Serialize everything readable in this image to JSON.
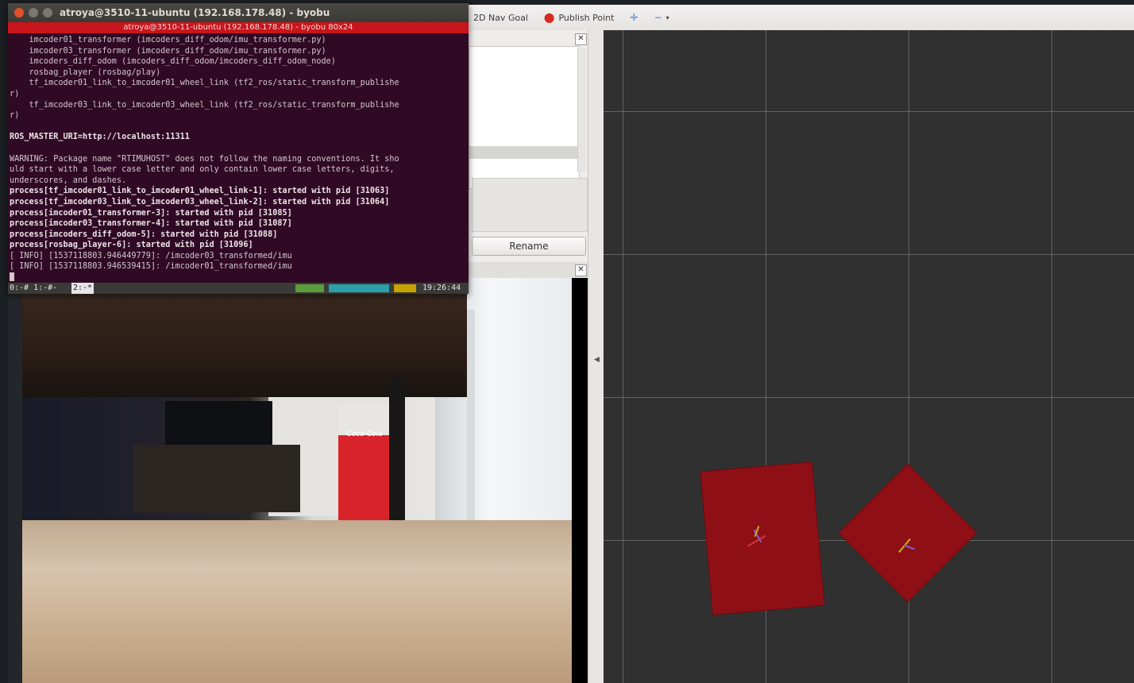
{
  "toolbar": {
    "nav_goal_label": "2D Nav Goal",
    "publish_point_label": "Publish Point"
  },
  "displays": {
    "rename_label": "Rename"
  },
  "terminal": {
    "window_title": "atroya@3510-11-ubuntu (192.168.178.48) - byobu",
    "tab_title": "atroya@3510-11-ubuntu (192.168.178.48) - byobu 80x24",
    "lines": [
      {
        "text": "    imcoder01_transformer (imcoders_diff_odom/imu_transformer.py)",
        "bold": false
      },
      {
        "text": "    imcoder03_transformer (imcoders_diff_odom/imu_transformer.py)",
        "bold": false
      },
      {
        "text": "    imcoders_diff_odom (imcoders_diff_odom/imcoders_diff_odom_node)",
        "bold": false
      },
      {
        "text": "    rosbag_player (rosbag/play)",
        "bold": false
      },
      {
        "text": "    tf_imcoder01_link_to_imcoder01_wheel_link (tf2_ros/static_transform_publishe",
        "bold": false
      },
      {
        "text": "r)",
        "bold": false
      },
      {
        "text": "    tf_imcoder03_link_to_imcoder03_wheel_link (tf2_ros/static_transform_publishe",
        "bold": false
      },
      {
        "text": "r)",
        "bold": false
      },
      {
        "text": "",
        "bold": false
      },
      {
        "text": "ROS_MASTER_URI=http://localhost:11311",
        "bold": true
      },
      {
        "text": "",
        "bold": false
      },
      {
        "text": "WARNING: Package name \"RTIMUHOST\" does not follow the naming conventions. It sho",
        "bold": false
      },
      {
        "text": "uld start with a lower case letter and only contain lower case letters, digits,",
        "bold": false
      },
      {
        "text": "underscores, and dashes.",
        "bold": false
      },
      {
        "text": "process[tf_imcoder01_link_to_imcoder01_wheel_link-1]: started with pid [31063]",
        "bold": true
      },
      {
        "text": "process[tf_imcoder03_link_to_imcoder03_wheel_link-2]: started with pid [31064]",
        "bold": true
      },
      {
        "text": "process[imcoder01_transformer-3]: started with pid [31085]",
        "bold": true
      },
      {
        "text": "process[imcoder03_transformer-4]: started with pid [31087]",
        "bold": true
      },
      {
        "text": "process[imcoders_diff_odom-5]: started with pid [31088]",
        "bold": true
      },
      {
        "text": "process[rosbag_player-6]: started with pid [31096]",
        "bold": true
      },
      {
        "text": "[ INFO] [1537118803.946449779]: /imcoder03_transformed/imu",
        "bold": false
      },
      {
        "text": "[ INFO] [1537118803.946539415]: /imcoder01_transformed/imu",
        "bold": false
      }
    ],
    "status_left": "0:-#  1:-#-",
    "status_active": "2:-*",
    "status_time": "19:26:44"
  },
  "camera": {
    "fridge_logo": "Coca-Cola"
  },
  "colors": {
    "terminal_bg": "#300a24",
    "tab_bar": "#c8151b",
    "cube_red": "#8e1016",
    "grid_bg": "#303030"
  }
}
